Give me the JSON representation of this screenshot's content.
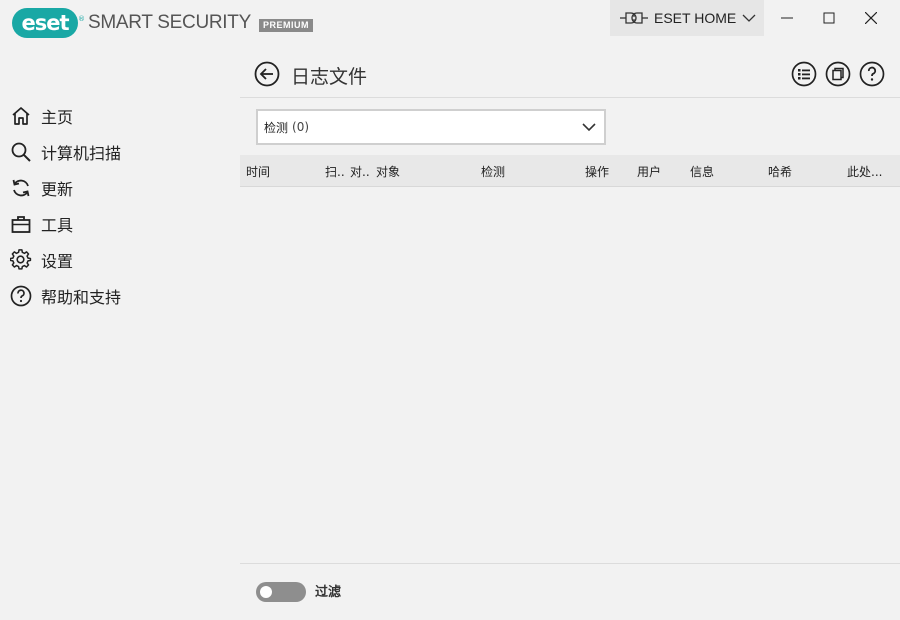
{
  "app": {
    "logo_text": "eset",
    "logo_reg": "®",
    "product_name": "SMART SECURITY",
    "edition_badge": "PREMIUM",
    "brand_color": "#19a8a5"
  },
  "titlebar": {
    "account_label": "ESET HOME",
    "account_icon": "connection-icon",
    "window_controls": [
      "minimize",
      "maximize",
      "close"
    ]
  },
  "sidebar": {
    "items": [
      {
        "label": "主页",
        "icon": "home-icon"
      },
      {
        "label": "计算机扫描",
        "icon": "search-icon"
      },
      {
        "label": "更新",
        "icon": "refresh-icon"
      },
      {
        "label": "工具",
        "icon": "briefcase-icon"
      },
      {
        "label": "设置",
        "icon": "gear-icon"
      },
      {
        "label": "帮助和支持",
        "icon": "help-icon"
      }
    ]
  },
  "main": {
    "title": "日志文件",
    "header_icons": [
      "list-icon",
      "copy-icon",
      "help-icon"
    ],
    "log_select": {
      "value": "检测",
      "count": "(0)"
    },
    "table": {
      "columns": [
        "时间",
        "扫..",
        "对..",
        "对象",
        "检测",
        "操作",
        "用户",
        "信息",
        "哈希",
        "此处..."
      ],
      "rows": []
    },
    "footer": {
      "filter_label": "过滤",
      "filter_enabled": false
    }
  }
}
